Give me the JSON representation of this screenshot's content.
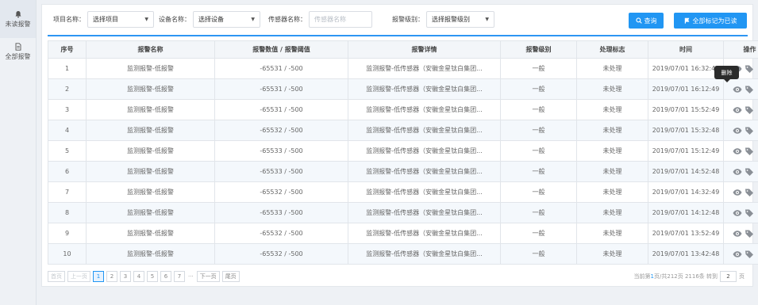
{
  "sidebar": {
    "items": [
      {
        "label": "未读报警",
        "icon": "bell-icon"
      },
      {
        "label": "全部报警",
        "icon": "document-icon"
      }
    ]
  },
  "filters": {
    "project_label": "项目名称：",
    "project_value": "选择项目",
    "device_label": "设备名称：",
    "device_value": "选择设备",
    "sensor_label": "传感器名称：",
    "sensor_placeholder": "传感器名称",
    "level_label": "报警级别：",
    "level_value": "选择报警级别"
  },
  "buttons": {
    "query": "查询",
    "mark_all_read": "全部标记为已读"
  },
  "colors": {
    "accent": "#2196f3",
    "status_unhandled": "#e53935"
  },
  "table": {
    "headers": [
      "序号",
      "报警名称",
      "报警数值 / 报警阈值",
      "报警详情",
      "报警级别",
      "处理标志",
      "时间",
      "操作"
    ],
    "rows": [
      {
        "no": "1",
        "name": "监测报警-低报警",
        "value": "-65531 / -500",
        "detail": "监测报警-低传感器（安徽金星钛白集团...",
        "level": "一般",
        "status": "未处理",
        "time": "2019/07/01 16:32:49"
      },
      {
        "no": "2",
        "name": "监测报警-低报警",
        "value": "-65531 / -500",
        "detail": "监测报警-低传感器（安徽金星钛白集团...",
        "level": "一般",
        "status": "未处理",
        "time": "2019/07/01 16:12:49"
      },
      {
        "no": "3",
        "name": "监测报警-低报警",
        "value": "-65531 / -500",
        "detail": "监测报警-低传感器（安徽金星钛白集团...",
        "level": "一般",
        "status": "未处理",
        "time": "2019/07/01 15:52:49"
      },
      {
        "no": "4",
        "name": "监测报警-低报警",
        "value": "-65532 / -500",
        "detail": "监测报警-低传感器（安徽金星钛白集团...",
        "level": "一般",
        "status": "未处理",
        "time": "2019/07/01 15:32:48"
      },
      {
        "no": "5",
        "name": "监测报警-低报警",
        "value": "-65533 / -500",
        "detail": "监测报警-低传感器（安徽金星钛白集团...",
        "level": "一般",
        "status": "未处理",
        "time": "2019/07/01 15:12:49"
      },
      {
        "no": "6",
        "name": "监测报警-低报警",
        "value": "-65533 / -500",
        "detail": "监测报警-低传感器（安徽金星钛白集团...",
        "level": "一般",
        "status": "未处理",
        "time": "2019/07/01 14:52:48"
      },
      {
        "no": "7",
        "name": "监测报警-低报警",
        "value": "-65532 / -500",
        "detail": "监测报警-低传感器（安徽金星钛白集团...",
        "level": "一般",
        "status": "未处理",
        "time": "2019/07/01 14:32:49"
      },
      {
        "no": "8",
        "name": "监测报警-低报警",
        "value": "-65533 / -500",
        "detail": "监测报警-低传感器（安徽金星钛白集团...",
        "level": "一般",
        "status": "未处理",
        "time": "2019/07/01 14:12:48"
      },
      {
        "no": "9",
        "name": "监测报警-低报警",
        "value": "-65532 / -500",
        "detail": "监测报警-低传感器（安徽金星钛白集团...",
        "level": "一般",
        "status": "未处理",
        "time": "2019/07/01 13:52:49"
      },
      {
        "no": "10",
        "name": "监测报警-低报警",
        "value": "-65532 / -500",
        "detail": "监测报警-低传感器（安徽金星钛白集团...",
        "level": "一般",
        "status": "未处理",
        "time": "2019/07/01 13:42:48"
      }
    ],
    "action_icons": [
      "eye-icon",
      "tag-icon",
      "trash-icon"
    ]
  },
  "tooltip": {
    "text": "删除"
  },
  "pagination": {
    "first": "首页",
    "prev": "上一页",
    "pages": [
      "1",
      "2",
      "3",
      "4",
      "5",
      "6",
      "7"
    ],
    "current_page": "1",
    "ellipsis": "···",
    "next": "下一页",
    "last": "尾页",
    "info_prefix": "当前第",
    "info_current": "1",
    "info_suffix": "页/共212页 2116条 转到",
    "jump_value": "2",
    "jump_unit": "页"
  }
}
